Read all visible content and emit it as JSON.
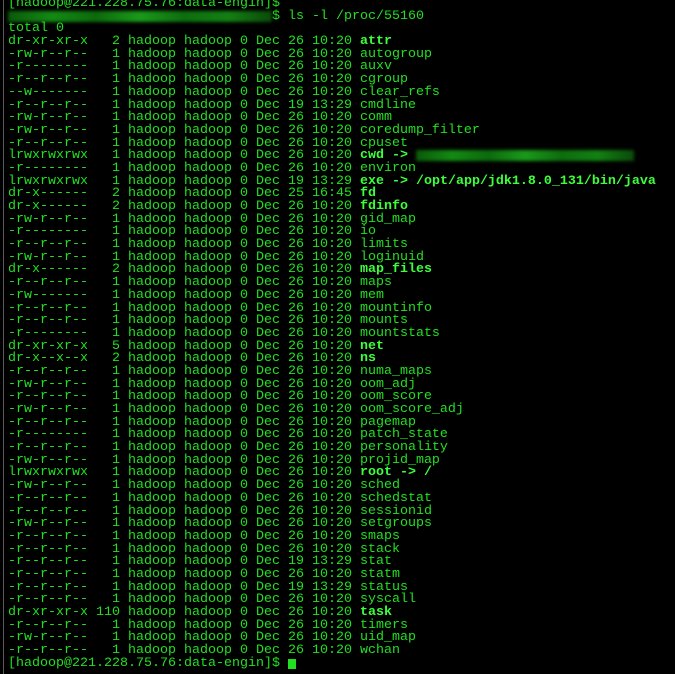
{
  "terminal": {
    "prev_prompt": "[hadoop@221.228.75.76:data-engin]$",
    "command_prompt_suffix": "$ ls -l /proc/55160",
    "total": "total 0",
    "owner": "hadoop",
    "group": "hadoop",
    "size": "0",
    "final_prompt": "[hadoop@221.228.75.76:data-engin]$ ",
    "colors": {
      "text": "#21e021",
      "bold": "#3cff3c",
      "background": "#000000"
    },
    "entries": [
      {
        "perms": "dr-xr-xr-x",
        "links": "2",
        "date": "Dec 26 10:20",
        "name": "attr",
        "bold": true
      },
      {
        "perms": "-rw-r--r--",
        "links": "1",
        "date": "Dec 26 10:20",
        "name": "autogroup"
      },
      {
        "perms": "-r--------",
        "links": "1",
        "date": "Dec 26 10:20",
        "name": "auxv"
      },
      {
        "perms": "-r--r--r--",
        "links": "1",
        "date": "Dec 26 10:20",
        "name": "cgroup"
      },
      {
        "perms": "--w-------",
        "links": "1",
        "date": "Dec 26 10:20",
        "name": "clear_refs"
      },
      {
        "perms": "-r--r--r--",
        "links": "1",
        "date": "Dec 19 13:29",
        "name": "cmdline"
      },
      {
        "perms": "-rw-r--r--",
        "links": "1",
        "date": "Dec 26 10:20",
        "name": "comm"
      },
      {
        "perms": "-rw-r--r--",
        "links": "1",
        "date": "Dec 26 10:20",
        "name": "coredump_filter"
      },
      {
        "perms": "-r--r--r--",
        "links": "1",
        "date": "Dec 26 10:20",
        "name": "cpuset"
      },
      {
        "perms": "lrwxrwxrwx",
        "links": "1",
        "date": "Dec 26 10:20",
        "name": "cwd",
        "bold": true,
        "target": "",
        "redacted": true
      },
      {
        "perms": "-r--------",
        "links": "1",
        "date": "Dec 26 10:20",
        "name": "environ"
      },
      {
        "perms": "lrwxrwxrwx",
        "links": "1",
        "date": "Dec 19 13:29",
        "name": "exe",
        "bold": true,
        "target": "/opt/app/jdk1.8.0_131/bin/java"
      },
      {
        "perms": "dr-x------",
        "links": "2",
        "date": "Dec 25 16:45",
        "name": "fd",
        "bold": true
      },
      {
        "perms": "dr-x------",
        "links": "2",
        "date": "Dec 26 10:20",
        "name": "fdinfo",
        "bold": true
      },
      {
        "perms": "-rw-r--r--",
        "links": "1",
        "date": "Dec 26 10:20",
        "name": "gid_map"
      },
      {
        "perms": "-r--------",
        "links": "1",
        "date": "Dec 26 10:20",
        "name": "io"
      },
      {
        "perms": "-r--r--r--",
        "links": "1",
        "date": "Dec 26 10:20",
        "name": "limits"
      },
      {
        "perms": "-rw-r--r--",
        "links": "1",
        "date": "Dec 26 10:20",
        "name": "loginuid"
      },
      {
        "perms": "dr-x------",
        "links": "2",
        "date": "Dec 26 10:20",
        "name": "map_files",
        "bold": true
      },
      {
        "perms": "-r--r--r--",
        "links": "1",
        "date": "Dec 26 10:20",
        "name": "maps"
      },
      {
        "perms": "-rw-------",
        "links": "1",
        "date": "Dec 26 10:20",
        "name": "mem"
      },
      {
        "perms": "-r--r--r--",
        "links": "1",
        "date": "Dec 26 10:20",
        "name": "mountinfo"
      },
      {
        "perms": "-r--r--r--",
        "links": "1",
        "date": "Dec 26 10:20",
        "name": "mounts"
      },
      {
        "perms": "-r--------",
        "links": "1",
        "date": "Dec 26 10:20",
        "name": "mountstats"
      },
      {
        "perms": "dr-xr-xr-x",
        "links": "5",
        "date": "Dec 26 10:20",
        "name": "net",
        "bold": true
      },
      {
        "perms": "dr-x--x--x",
        "links": "2",
        "date": "Dec 26 10:20",
        "name": "ns",
        "bold": true
      },
      {
        "perms": "-r--r--r--",
        "links": "1",
        "date": "Dec 26 10:20",
        "name": "numa_maps"
      },
      {
        "perms": "-rw-r--r--",
        "links": "1",
        "date": "Dec 26 10:20",
        "name": "oom_adj"
      },
      {
        "perms": "-r--r--r--",
        "links": "1",
        "date": "Dec 26 10:20",
        "name": "oom_score"
      },
      {
        "perms": "-rw-r--r--",
        "links": "1",
        "date": "Dec 26 10:20",
        "name": "oom_score_adj"
      },
      {
        "perms": "-r--r--r--",
        "links": "1",
        "date": "Dec 26 10:20",
        "name": "pagemap"
      },
      {
        "perms": "-r--------",
        "links": "1",
        "date": "Dec 26 10:20",
        "name": "patch_state"
      },
      {
        "perms": "-r--r--r--",
        "links": "1",
        "date": "Dec 26 10:20",
        "name": "personality"
      },
      {
        "perms": "-rw-r--r--",
        "links": "1",
        "date": "Dec 26 10:20",
        "name": "projid_map"
      },
      {
        "perms": "lrwxrwxrwx",
        "links": "1",
        "date": "Dec 26 10:20",
        "name": "root",
        "bold": true,
        "target": "/"
      },
      {
        "perms": "-rw-r--r--",
        "links": "1",
        "date": "Dec 26 10:20",
        "name": "sched"
      },
      {
        "perms": "-r--r--r--",
        "links": "1",
        "date": "Dec 26 10:20",
        "name": "schedstat"
      },
      {
        "perms": "-r--r--r--",
        "links": "1",
        "date": "Dec 26 10:20",
        "name": "sessionid"
      },
      {
        "perms": "-rw-r--r--",
        "links": "1",
        "date": "Dec 26 10:20",
        "name": "setgroups"
      },
      {
        "perms": "-r--r--r--",
        "links": "1",
        "date": "Dec 26 10:20",
        "name": "smaps"
      },
      {
        "perms": "-r--r--r--",
        "links": "1",
        "date": "Dec 26 10:20",
        "name": "stack"
      },
      {
        "perms": "-r--r--r--",
        "links": "1",
        "date": "Dec 19 13:29",
        "name": "stat"
      },
      {
        "perms": "-r--r--r--",
        "links": "1",
        "date": "Dec 26 10:20",
        "name": "statm"
      },
      {
        "perms": "-r--r--r--",
        "links": "1",
        "date": "Dec 19 13:29",
        "name": "status"
      },
      {
        "perms": "-r--r--r--",
        "links": "1",
        "date": "Dec 26 10:20",
        "name": "syscall"
      },
      {
        "perms": "dr-xr-xr-x",
        "links": "110",
        "date": "Dec 26 10:20",
        "name": "task",
        "bold": true
      },
      {
        "perms": "-r--r--r--",
        "links": "1",
        "date": "Dec 26 10:20",
        "name": "timers"
      },
      {
        "perms": "-rw-r--r--",
        "links": "1",
        "date": "Dec 26 10:20",
        "name": "uid_map"
      },
      {
        "perms": "-r--r--r--",
        "links": "1",
        "date": "Dec 26 10:20",
        "name": "wchan"
      }
    ]
  }
}
